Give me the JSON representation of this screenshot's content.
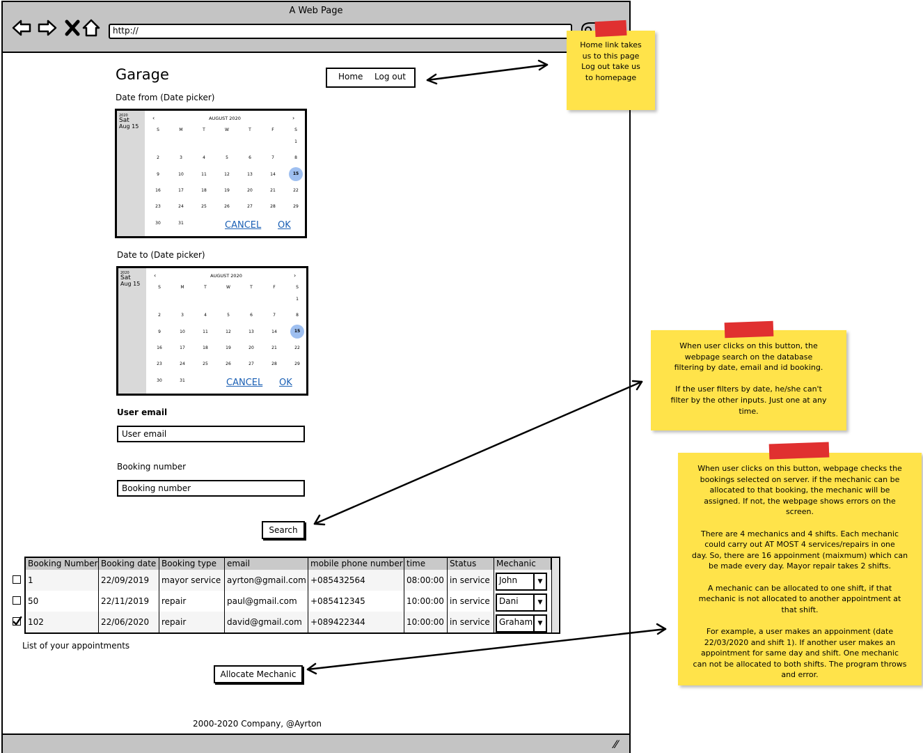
{
  "window": {
    "title": "A Web Page",
    "url": "http://"
  },
  "page": {
    "title": "Garage",
    "nav": {
      "home": "Home",
      "logout": "Log out"
    },
    "date_from_label": "Date from (Date picker)",
    "date_to_label": "Date to (Date picker)",
    "email_label": "User email",
    "email_placeholder": "User email",
    "booking_label": "Booking number",
    "booking_placeholder": "Booking number",
    "search_button": "Search",
    "list_caption": "List of your appointments",
    "allocate_button": "Allocate Mechanic",
    "footer": "2000-2020 Company, @Ayrton"
  },
  "datepicker": {
    "year": "2020",
    "weekday": "Sat",
    "date": "Aug 15",
    "month": "AUGUST 2020",
    "prev": "‹",
    "next": "›",
    "weekdays": [
      "S",
      "M",
      "T",
      "W",
      "T",
      "F",
      "S"
    ],
    "selected_day": 15,
    "cancel": "CANCEL",
    "ok": "OK"
  },
  "table": {
    "headers": [
      "Booking Number",
      "Booking date",
      "Booking type",
      "email",
      "mobile phone number",
      "time",
      "Status",
      "Mechanic"
    ],
    "rows": [
      {
        "checked": false,
        "booking_number": "1",
        "booking_date": "22/09/2019",
        "booking_type": "mayor service",
        "email": "ayrton@gmail.com",
        "phone": "+085432564",
        "time": "08:00:00",
        "status": "in service",
        "mechanic": "John"
      },
      {
        "checked": false,
        "booking_number": "50",
        "booking_date": "22/11/2019",
        "booking_type": "repair",
        "email": "paul@gmail.com",
        "phone": "+085412345",
        "time": "10:00:00",
        "status": "in service",
        "mechanic": "Dani"
      },
      {
        "checked": true,
        "booking_number": "102",
        "booking_date": "22/06/2020",
        "booking_type": "repair",
        "email": "david@gmail.com",
        "phone": "+089422344",
        "time": "10:00:00",
        "status": "in service",
        "mechanic": "Graham"
      }
    ]
  },
  "notes": {
    "nav_note": [
      "Home link takes",
      "us to this page",
      "Log out take us",
      "to homepage"
    ],
    "search_note": [
      "When user clicks on this button, the",
      "webpage search on the database",
      "filtering by date, email and id booking.",
      "",
      "If the user filters by date, he/she can't",
      "filter by the other inputs. Just one at any",
      "time."
    ],
    "allocate_note": [
      "When user clicks on this button, webpage checks the",
      "bookings selected on server. if the mechanic can be",
      "allocated to that booking, the mechanic will be",
      "assigned. If not, the webpage shows errors on the",
      "screen.",
      "",
      "There are 4 mechanics and 4 shifts. Each  mechanic",
      "could carry out AT MOST 4 services/repairs in one",
      "day. So, there are 16 appoinment (maixmum) which can",
      "be made every day. Mayor repair takes 2 shifts.",
      "",
      "A mechanic can be allocated to one shift, if that",
      "mechanic is not allocated to another appointment at",
      "that shift.",
      "",
      "For example, a user makes an appoinment (date",
      "22/03/2020 and shift 1). If another user makes an",
      "appointment for same day and shift. One mechanic",
      "can not be allocated to both shifts. The program throws",
      "and error."
    ]
  },
  "colors": {
    "note": "#ffe34a",
    "tape": "#e03030",
    "chrome": "#c4c4c4",
    "header": "#c9c9c9",
    "link": "#1a5fb4",
    "selected_day": "#9ebff0"
  }
}
